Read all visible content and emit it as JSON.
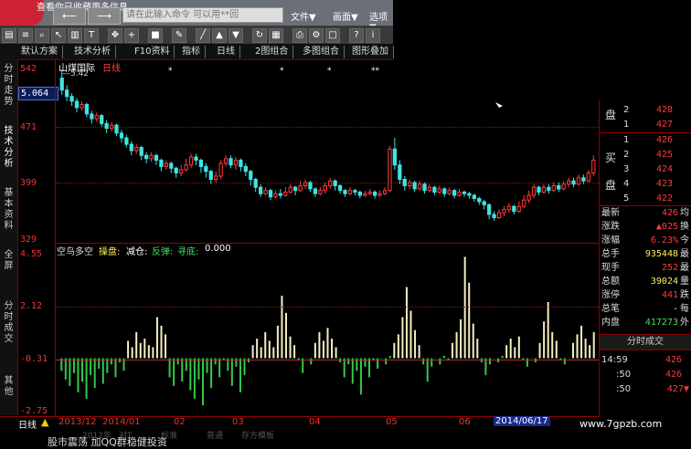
{
  "window": {
    "title_hint": "查看你已收藏更多信息",
    "command_placeholder": "请在此输入命令 可以用**回",
    "menu": [
      "文件▼",
      "画面▼",
      "选项▼"
    ]
  },
  "toolbar": {
    "tabs": [
      "默认方案",
      "技术分析",
      "F10资料",
      "指标",
      "日线",
      "2图组合",
      "多图组合",
      "图形叠加"
    ]
  },
  "left_tabs": [
    "分时走势",
    "技术分析",
    "基本资料",
    "全屏",
    "分时成交",
    "其他"
  ],
  "stock": {
    "name": "山煤国际",
    "period": "日线",
    "ma_label": "—5.42",
    "current_price_box": "5.064"
  },
  "price_axis": [
    "542",
    "471",
    "399",
    "329"
  ],
  "indicator": {
    "title": "空鸟多空",
    "labels": [
      "操盘:",
      "减仓:",
      "反弹:",
      "寻底:"
    ],
    "value": "0.000",
    "axis": [
      "4.55",
      "2.12",
      "-0.31",
      "-2.75"
    ]
  },
  "time_axis": [
    "日线",
    "2013/12",
    "2014/01",
    "02",
    "03",
    "04",
    "05",
    "06",
    "2014/06/17"
  ],
  "order_book": {
    "sell_label": [
      "盘",
      ""
    ],
    "sell": [
      {
        "level": "2",
        "price": "428"
      },
      {
        "level": "1",
        "price": "427"
      }
    ],
    "buy_label": [
      "买",
      "盘"
    ],
    "buy": [
      {
        "level": "1",
        "price": "426"
      },
      {
        "level": "2",
        "price": "425"
      },
      {
        "level": "3",
        "price": "424"
      },
      {
        "level": "4",
        "price": "423"
      },
      {
        "level": "5",
        "price": "422"
      }
    ]
  },
  "quote": [
    {
      "label": "最新",
      "value": "426",
      "tail": "均"
    },
    {
      "label": "涨跌",
      "value": "▲025",
      "tail": "换"
    },
    {
      "label": "涨幅",
      "value": "6.23%",
      "tail": "今"
    },
    {
      "label": "总手",
      "value": "935448",
      "tail": "最"
    },
    {
      "label": "现手",
      "value": "252",
      "tail": "最"
    },
    {
      "label": "总额",
      "value": "39024",
      "tail": "量"
    },
    {
      "label": "涨停",
      "value": "441",
      "tail": "跌"
    },
    {
      "label": "总笔",
      "value": "-",
      "tail": "每"
    },
    {
      "label": "内盘",
      "value": "417273",
      "tail": "外"
    }
  ],
  "ticks_header": "分时成交",
  "ticks": [
    {
      "time": "14:59",
      "price": "426"
    },
    {
      "time": ":50",
      "price": "426"
    },
    {
      "time": ":50",
      "price": "427▼"
    }
  ],
  "bottom_tabs": [
    "2012年",
    "对T",
    "标准",
    "普通",
    "存方模板"
  ],
  "news": "股市震荡 加QQ群稳健投资",
  "watermark": "www.7gpzb.com",
  "chart_data": {
    "type": "candlestick",
    "title": "山煤国际 日线",
    "ylim": [
      3.29,
      5.42
    ],
    "candles": [
      [
        5.31,
        5.16,
        5.42,
        5.1
      ],
      [
        5.16,
        5.08,
        5.22,
        5.02
      ],
      [
        5.08,
        5.02,
        5.12,
        4.96
      ],
      [
        5.02,
        4.94,
        5.06,
        4.88
      ],
      [
        4.94,
        4.98,
        5.02,
        4.9
      ],
      [
        4.98,
        4.86,
        5.0,
        4.82
      ],
      [
        4.86,
        4.8,
        4.9,
        4.74
      ],
      [
        4.8,
        4.84,
        4.88,
        4.76
      ],
      [
        4.84,
        4.74,
        4.86,
        4.7
      ],
      [
        4.74,
        4.68,
        4.78,
        4.62
      ],
      [
        4.68,
        4.72,
        4.76,
        4.64
      ],
      [
        4.72,
        4.62,
        4.74,
        4.58
      ],
      [
        4.62,
        4.56,
        4.66,
        4.5
      ],
      [
        4.56,
        4.48,
        4.6,
        4.44
      ],
      [
        4.48,
        4.4,
        4.52,
        4.34
      ],
      [
        4.4,
        4.44,
        4.48,
        4.36
      ],
      [
        4.44,
        4.34,
        4.46,
        4.28
      ],
      [
        4.34,
        4.3,
        4.38,
        4.24
      ],
      [
        4.3,
        4.34,
        4.38,
        4.26
      ],
      [
        4.34,
        4.28,
        4.36,
        4.22
      ],
      [
        4.28,
        4.2,
        4.3,
        4.14
      ],
      [
        4.2,
        4.24,
        4.28,
        4.16
      ],
      [
        4.24,
        4.18,
        4.26,
        4.12
      ],
      [
        4.18,
        4.12,
        4.2,
        4.06
      ],
      [
        4.12,
        4.16,
        4.22,
        4.08
      ],
      [
        4.16,
        4.22,
        4.3,
        4.14
      ],
      [
        4.22,
        4.32,
        4.36,
        4.18
      ],
      [
        4.32,
        4.28,
        4.36,
        4.22
      ],
      [
        4.28,
        4.2,
        4.3,
        4.12
      ],
      [
        4.2,
        4.14,
        4.24,
        4.06
      ],
      [
        4.14,
        4.04,
        4.16,
        3.98
      ],
      [
        4.04,
        4.08,
        4.14,
        4.0
      ],
      [
        4.08,
        4.24,
        4.28,
        4.04
      ],
      [
        4.24,
        4.3,
        4.34,
        4.2
      ],
      [
        4.3,
        4.22,
        4.34,
        4.18
      ],
      [
        4.22,
        4.28,
        4.32,
        4.16
      ],
      [
        4.28,
        4.2,
        4.3,
        4.14
      ],
      [
        4.2,
        4.14,
        4.24,
        4.08
      ],
      [
        4.14,
        4.04,
        4.16,
        3.96
      ],
      [
        4.04,
        3.94,
        4.06,
        3.88
      ],
      [
        3.94,
        3.86,
        3.98,
        3.82
      ],
      [
        3.86,
        3.9,
        3.94,
        3.84
      ],
      [
        3.9,
        3.82,
        3.92,
        3.78
      ],
      [
        3.82,
        3.86,
        3.9,
        3.8
      ],
      [
        3.86,
        3.84,
        3.92,
        3.8
      ],
      [
        3.84,
        3.88,
        3.94,
        3.82
      ],
      [
        3.88,
        3.94,
        3.98,
        3.86
      ],
      [
        3.94,
        3.9,
        3.96,
        3.84
      ],
      [
        3.9,
        3.96,
        4.02,
        3.88
      ],
      [
        3.96,
        4.0,
        4.04,
        3.92
      ],
      [
        4.0,
        3.92,
        4.02,
        3.88
      ],
      [
        3.92,
        3.86,
        3.94,
        3.82
      ],
      [
        3.86,
        3.9,
        3.94,
        3.84
      ],
      [
        3.9,
        3.96,
        4.0,
        3.86
      ],
      [
        3.96,
        4.02,
        4.06,
        3.92
      ],
      [
        4.02,
        3.96,
        4.04,
        3.9
      ],
      [
        3.96,
        3.9,
        3.98,
        3.86
      ],
      [
        3.9,
        3.86,
        3.92,
        3.82
      ],
      [
        3.86,
        3.9,
        3.94,
        3.84
      ],
      [
        3.9,
        3.88,
        3.92,
        3.84
      ],
      [
        3.88,
        3.84,
        3.9,
        3.8
      ],
      [
        3.84,
        3.86,
        3.9,
        3.82
      ],
      [
        3.86,
        3.88,
        3.92,
        3.84
      ],
      [
        3.88,
        3.84,
        3.9,
        3.8
      ],
      [
        3.84,
        3.86,
        3.9,
        3.82
      ],
      [
        3.86,
        3.9,
        3.94,
        3.84
      ],
      [
        3.9,
        4.42,
        4.46,
        3.88
      ],
      [
        4.42,
        4.22,
        4.56,
        4.16
      ],
      [
        4.22,
        4.04,
        4.28,
        3.98
      ],
      [
        4.04,
        3.96,
        4.08,
        3.9
      ],
      [
        3.96,
        4.0,
        4.04,
        3.92
      ],
      [
        4.0,
        3.92,
        4.02,
        3.88
      ],
      [
        3.92,
        3.98,
        4.02,
        3.9
      ],
      [
        3.98,
        3.9,
        4.0,
        3.86
      ],
      [
        3.9,
        3.94,
        3.98,
        3.88
      ],
      [
        3.94,
        3.88,
        3.96,
        3.84
      ],
      [
        3.88,
        3.92,
        3.96,
        3.86
      ],
      [
        3.92,
        3.86,
        3.94,
        3.82
      ],
      [
        3.86,
        3.9,
        3.94,
        3.84
      ],
      [
        3.9,
        3.84,
        3.92,
        3.8
      ],
      [
        3.84,
        3.88,
        3.92,
        3.82
      ],
      [
        3.88,
        3.86,
        3.9,
        3.82
      ],
      [
        3.86,
        3.84,
        3.88,
        3.8
      ],
      [
        3.84,
        3.8,
        3.86,
        3.76
      ],
      [
        3.8,
        3.76,
        3.82,
        3.72
      ],
      [
        3.76,
        3.72,
        3.78,
        3.66
      ],
      [
        3.72,
        3.6,
        3.74,
        3.54
      ],
      [
        3.6,
        3.56,
        3.64,
        3.52
      ],
      [
        3.56,
        3.62,
        3.66,
        3.54
      ],
      [
        3.62,
        3.66,
        3.7,
        3.58
      ],
      [
        3.66,
        3.7,
        3.74,
        3.62
      ],
      [
        3.7,
        3.64,
        3.72,
        3.6
      ],
      [
        3.64,
        3.7,
        3.76,
        3.62
      ],
      [
        3.7,
        3.78,
        3.84,
        3.68
      ],
      [
        3.78,
        3.84,
        3.9,
        3.74
      ],
      [
        3.84,
        3.94,
        3.98,
        3.8
      ],
      [
        3.94,
        3.88,
        3.96,
        3.84
      ],
      [
        3.88,
        3.94,
        3.98,
        3.86
      ],
      [
        3.94,
        3.9,
        3.98,
        3.86
      ],
      [
        3.9,
        3.96,
        4.0,
        3.88
      ],
      [
        3.96,
        3.92,
        4.0,
        3.88
      ],
      [
        3.92,
        3.98,
        4.02,
        3.9
      ],
      [
        3.98,
        4.02,
        4.06,
        3.94
      ],
      [
        4.02,
        3.98,
        4.06,
        3.94
      ],
      [
        3.98,
        4.06,
        4.1,
        3.96
      ],
      [
        4.06,
        4.02,
        4.1,
        3.98
      ],
      [
        4.02,
        4.12,
        4.16,
        4.0
      ],
      [
        4.12,
        4.28,
        4.34,
        4.08
      ]
    ],
    "indicator_ylim": [
      -2.75,
      4.55
    ],
    "indicator_values": [
      -0.9,
      -1.3,
      -1.6,
      -1.0,
      -1.9,
      -1.4,
      -2.2,
      -1.1,
      -1.7,
      -0.8,
      -1.5,
      -1.0,
      -0.6,
      -1.2,
      -0.5,
      -0.9,
      0.5,
      0.2,
      0.9,
      0.4,
      0.6,
      0.3,
      0.2,
      1.6,
      1.2,
      0.8,
      -1.2,
      -1.6,
      -0.6,
      -1.4,
      -0.9,
      -1.8,
      -2.2,
      -1.3,
      -2.5,
      -1.0,
      -1.7,
      -0.6,
      -1.2,
      -0.4,
      -0.9,
      -1.6,
      -0.7,
      -1.9,
      -1.1,
      -0.5,
      0.3,
      0.6,
      0.2,
      0.9,
      0.5,
      0.2,
      1.2,
      2.6,
      1.8,
      0.7,
      0.3,
      -0.4,
      -1.0,
      -0.3,
      -0.6,
      0.4,
      0.9,
      0.5,
      1.1,
      0.6,
      0.2,
      -0.5,
      -1.2,
      -0.6,
      -1.5,
      -0.9,
      -2.0,
      -0.7,
      -1.2,
      -0.4,
      -0.8,
      -0.3,
      -0.6,
      -0.2,
      0.4,
      0.8,
      1.6,
      3.0,
      1.9,
      1.0,
      0.3,
      -0.6,
      -1.4,
      -0.7,
      -0.3,
      -0.6,
      -0.2,
      -0.4,
      0.4,
      0.9,
      1.5,
      4.4,
      3.2,
      1.3,
      0.6,
      -0.5,
      -1.1,
      -0.6,
      -0.3,
      -0.5,
      -0.2,
      0.3,
      0.6,
      0.2,
      0.7,
      -0.4,
      -0.7,
      -0.3,
      -0.5,
      0.4,
      1.4,
      2.3,
      0.9,
      0.5,
      -0.4,
      -0.6,
      -0.3,
      0.4,
      0.8,
      1.2,
      0.6,
      0.3,
      0.9
    ]
  }
}
